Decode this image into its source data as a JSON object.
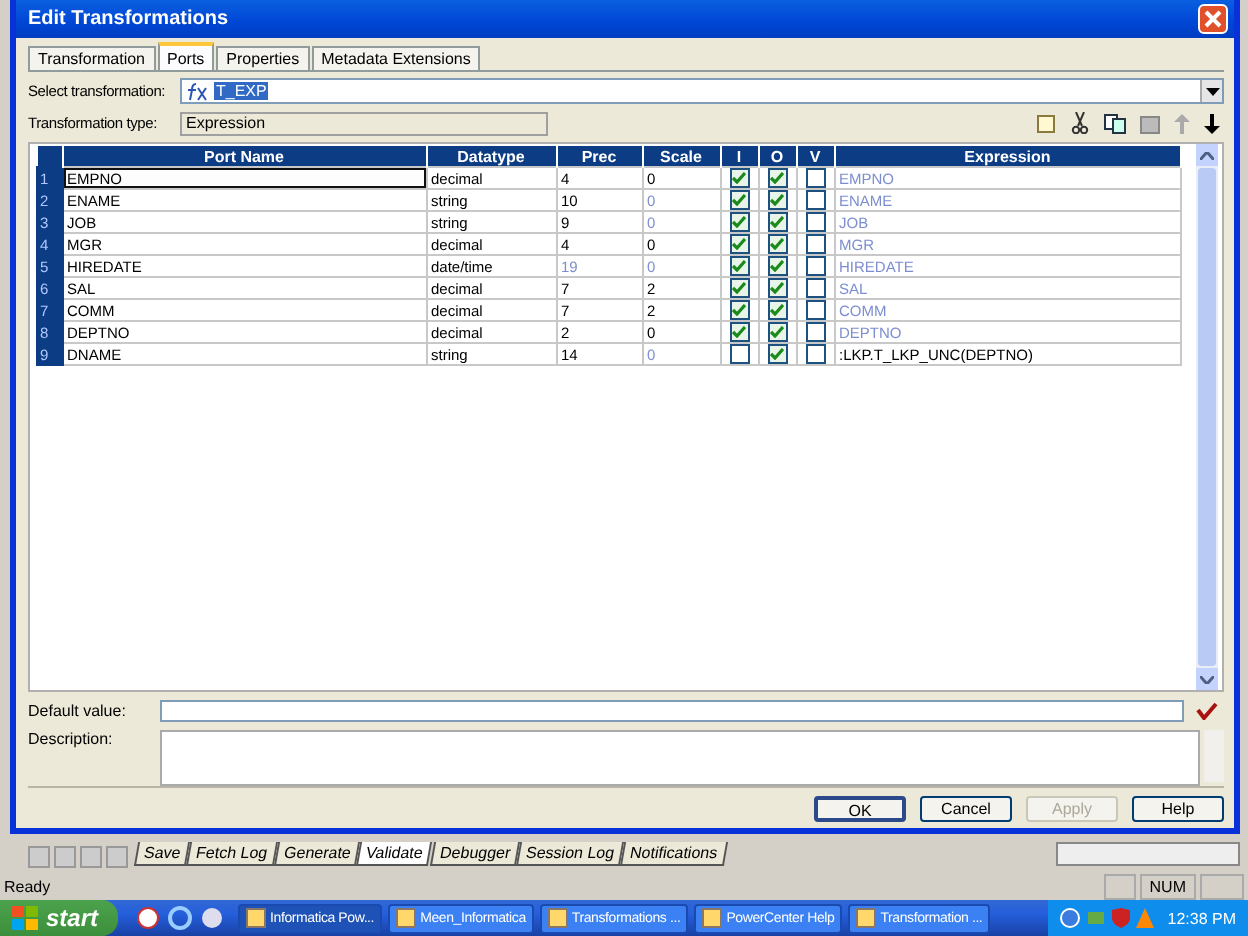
{
  "window": {
    "title": "Edit Transformations"
  },
  "tabs": [
    {
      "label": "Transformation",
      "selected": false
    },
    {
      "label": "Ports",
      "selected": true
    },
    {
      "label": "Properties",
      "selected": false
    },
    {
      "label": "Metadata Extensions",
      "selected": false
    }
  ],
  "select_transformation": {
    "label": "Select transformation:",
    "value": "T_EXP"
  },
  "transformation_type": {
    "label": "Transformation type:",
    "value": "Expression"
  },
  "table": {
    "columns": [
      "Port Name",
      "Datatype",
      "Prec",
      "Scale",
      "I",
      "O",
      "V",
      "Expression"
    ],
    "rows": [
      {
        "number": "1",
        "port_name": "EMPNO",
        "datatype": "decimal",
        "prec": "4",
        "prec_disabled": false,
        "scale": "0",
        "scale_disabled": false,
        "input": true,
        "output": true,
        "variable": false,
        "expression": "EMPNO",
        "expression_disabled": true,
        "selected": true
      },
      {
        "number": "2",
        "port_name": "ENAME",
        "datatype": "string",
        "prec": "10",
        "prec_disabled": false,
        "scale": "0",
        "scale_disabled": true,
        "input": true,
        "output": true,
        "variable": false,
        "expression": "ENAME",
        "expression_disabled": true,
        "selected": false
      },
      {
        "number": "3",
        "port_name": "JOB",
        "datatype": "string",
        "prec": "9",
        "prec_disabled": false,
        "scale": "0",
        "scale_disabled": true,
        "input": true,
        "output": true,
        "variable": false,
        "expression": "JOB",
        "expression_disabled": true,
        "selected": false
      },
      {
        "number": "4",
        "port_name": "MGR",
        "datatype": "decimal",
        "prec": "4",
        "prec_disabled": false,
        "scale": "0",
        "scale_disabled": false,
        "input": true,
        "output": true,
        "variable": false,
        "expression": "MGR",
        "expression_disabled": true,
        "selected": false
      },
      {
        "number": "5",
        "port_name": "HIREDATE",
        "datatype": "date/time",
        "prec": "19",
        "prec_disabled": true,
        "scale": "0",
        "scale_disabled": true,
        "input": true,
        "output": true,
        "variable": false,
        "expression": "HIREDATE",
        "expression_disabled": true,
        "selected": false
      },
      {
        "number": "6",
        "port_name": "SAL",
        "datatype": "decimal",
        "prec": "7",
        "prec_disabled": false,
        "scale": "2",
        "scale_disabled": false,
        "input": true,
        "output": true,
        "variable": false,
        "expression": "SAL",
        "expression_disabled": true,
        "selected": false
      },
      {
        "number": "7",
        "port_name": "COMM",
        "datatype": "decimal",
        "prec": "7",
        "prec_disabled": false,
        "scale": "2",
        "scale_disabled": false,
        "input": true,
        "output": true,
        "variable": false,
        "expression": "COMM",
        "expression_disabled": true,
        "selected": false
      },
      {
        "number": "8",
        "port_name": "DEPTNO",
        "datatype": "decimal",
        "prec": "2",
        "prec_disabled": false,
        "scale": "0",
        "scale_disabled": false,
        "input": true,
        "output": true,
        "variable": false,
        "expression": "DEPTNO",
        "expression_disabled": true,
        "selected": false
      },
      {
        "number": "9",
        "port_name": "DNAME",
        "datatype": "string",
        "prec": "14",
        "prec_disabled": false,
        "scale": "0",
        "scale_disabled": true,
        "input": false,
        "output": true,
        "variable": false,
        "expression": ":LKP.T_LKP_UNC(DEPTNO)",
        "expression_disabled": false,
        "selected": false
      }
    ]
  },
  "default_value": {
    "label": "Default value:"
  },
  "description": {
    "label": "Description:"
  },
  "buttons": [
    {
      "label": "OK",
      "disabled": false
    },
    {
      "label": "Cancel",
      "disabled": false
    },
    {
      "label": "Apply",
      "disabled": true
    },
    {
      "label": "Help",
      "disabled": false
    }
  ],
  "output_tabs": [
    {
      "label": "Save",
      "selected": false
    },
    {
      "label": "Fetch Log",
      "selected": false
    },
    {
      "label": "Generate",
      "selected": false
    },
    {
      "label": "Validate",
      "selected": true
    },
    {
      "label": "Debugger",
      "selected": false
    },
    {
      "label": "Session Log",
      "selected": false
    },
    {
      "label": "Notifications",
      "selected": false
    }
  ],
  "status_bar": {
    "text": "Ready",
    "indicator": "NUM"
  },
  "taskbar": {
    "start": "start",
    "tasks": [
      {
        "label": "Informatica Pow...",
        "selected": true
      },
      {
        "label": "Meen_Informatica",
        "selected": false
      },
      {
        "label": "Transformations ...",
        "selected": false
      },
      {
        "label": "PowerCenter Help",
        "selected": false
      },
      {
        "label": "Transformation ...",
        "selected": false
      }
    ],
    "clock": "12:38 PM"
  }
}
